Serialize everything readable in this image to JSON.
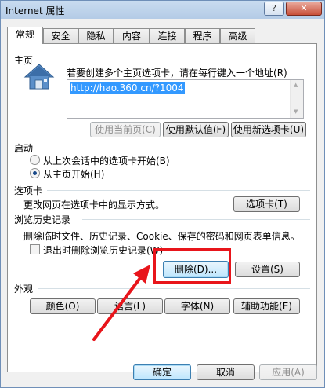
{
  "window": {
    "title": "Internet 属性",
    "help": "?",
    "close": "✕"
  },
  "tabs": [
    "常规",
    "安全",
    "隐私",
    "内容",
    "连接",
    "程序",
    "高级"
  ],
  "home": {
    "title": "主页",
    "description": "若要创建多个主页选项卡，请在每行键入一个地址",
    "desc_key": "(R)",
    "url": "http://hao.360.cn/?1004",
    "btn_current": "使用当前页(C)",
    "btn_default": "使用默认值(F)",
    "btn_newtab": "使用新选项卡(U)"
  },
  "startup": {
    "title": "启动",
    "option1": "从上次会话中的选项卡开始(B)",
    "option2": "从主页开始(H)"
  },
  "tabs_section": {
    "title": "选项卡",
    "description": "更改网页在选项卡中的显示方式。",
    "button": "选项卡(T)"
  },
  "history": {
    "title": "浏览历史记录",
    "description": "删除临时文件、历史记录、Cookie、保存的密码和网页表单信息。",
    "checkbox": "退出时删除浏览历史记录(W)",
    "btn_delete": "删除(D)...",
    "btn_settings": "设置(S)"
  },
  "appearance": {
    "title": "外观",
    "btn_colors": "颜色(O)",
    "btn_languages": "语言(L)",
    "btn_fonts": "字体(N)",
    "btn_accessibility": "辅助功能(E)"
  },
  "footer": {
    "ok": "确定",
    "cancel": "取消",
    "apply": "应用(A)"
  },
  "colors": {
    "highlight": "#e8151b",
    "arrow": "#e8151b",
    "selection": "#3399ff"
  }
}
